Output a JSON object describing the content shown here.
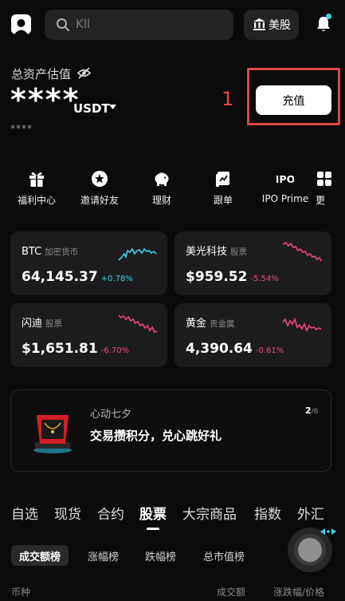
{
  "header": {
    "search_placeholder": "Kll",
    "market_label": "美股"
  },
  "assets": {
    "title": "总资产估值",
    "masked_value": "****",
    "unit": "USDT",
    "sub_masked": "****",
    "marker_number": "1",
    "deposit_label": "充值"
  },
  "quick_actions": [
    {
      "label": "福利中心",
      "icon": "gift-icon"
    },
    {
      "label": "邀请好友",
      "icon": "invite-icon"
    },
    {
      "label": "理财",
      "icon": "piggy-bank-icon"
    },
    {
      "label": "跟单",
      "icon": "copy-trade-icon"
    },
    {
      "label": "IPO Prime",
      "icon": "ipo-icon"
    },
    {
      "label": "更",
      "icon": "more-icon"
    }
  ],
  "markets": [
    {
      "name": "BTC",
      "tag": "加密货币",
      "price": "64,145.37",
      "change": "+0.78%",
      "color": "#3fd0e8"
    },
    {
      "name": "美光科技",
      "tag": "股票",
      "price": "$959.52",
      "change": "-5.54%",
      "color": "#f0457a"
    },
    {
      "name": "闪迪",
      "tag": "股票",
      "price": "$1,651.81",
      "change": "-6.70%",
      "color": "#f0457a"
    },
    {
      "name": "黄金",
      "tag": "贵金属",
      "price": "4,390.64",
      "change": "-0.61%",
      "color": "#f0457a"
    }
  ],
  "banner": {
    "subtitle": "心动七夕",
    "title": "交易攒积分，兑心跳好礼",
    "page_current": "2",
    "page_total": "/6"
  },
  "tabs": [
    "自选",
    "现货",
    "合约",
    "股票",
    "大宗商品",
    "指数",
    "外汇"
  ],
  "active_tab": "股票",
  "sub_tabs": [
    "成交额榜",
    "涨幅榜",
    "跌幅榜",
    "总市值榜"
  ],
  "columns": {
    "left": "币种",
    "middle": "成交额",
    "right": "涨跌幅/价格"
  },
  "colors": {
    "up": "#3fd0e8",
    "down": "#f0457a",
    "highlight": "#e04747"
  }
}
